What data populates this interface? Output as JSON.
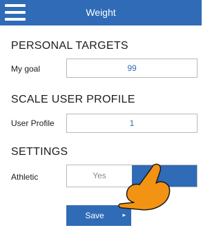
{
  "header": {
    "title": "Weight",
    "menu_icon": "hamburger-menu-icon"
  },
  "personal_targets": {
    "title": "PERSONAL TARGETS",
    "goal_label": "My goal",
    "goal_value": "99"
  },
  "scale_user_profile": {
    "title": "SCALE USER PROFILE",
    "profile_label": "User Profile",
    "profile_value": "1"
  },
  "settings": {
    "title": "SETTINGS",
    "athletic_label": "Athletic",
    "athletic_options": [
      "Yes",
      ""
    ],
    "athletic_selected": "No"
  },
  "save_button": {
    "label": "Save",
    "icon": "chevron-right-icon"
  },
  "overlay": {
    "icon": "pointing-hand-icon",
    "color": "#f39313"
  },
  "colors": {
    "accent": "#2f6bb6",
    "border": "#b9b9b9"
  }
}
